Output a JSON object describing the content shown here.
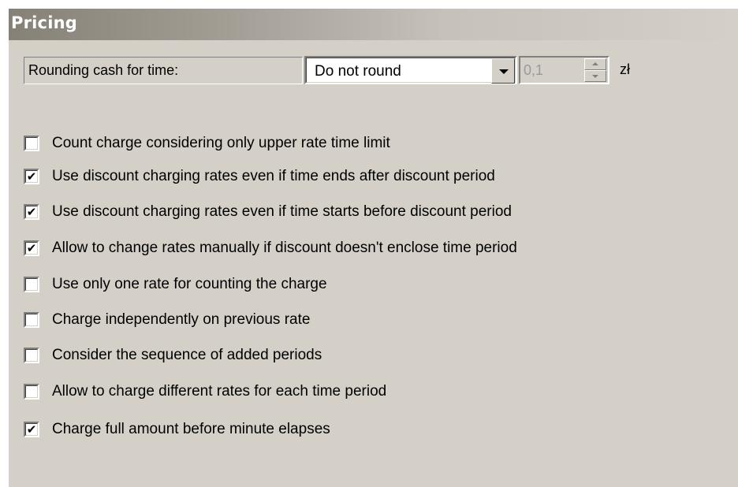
{
  "header": {
    "title": "Pricing"
  },
  "rounding": {
    "label": "Rounding cash for time:",
    "selected": "Do not round",
    "amount": "0,1",
    "currency": "zł"
  },
  "options": [
    {
      "label": "Count charge considering only upper rate time limit",
      "checked": false
    },
    {
      "label": "Use discount charging rates even if time ends after discount period",
      "checked": true
    },
    {
      "label": "Use discount charging rates even if time starts before discount period",
      "checked": true
    },
    {
      "label": "Allow to change rates manually if discount doesn't enclose time period",
      "checked": true
    },
    {
      "label": "Use only one rate for counting the charge",
      "checked": false
    },
    {
      "label": "Charge independently on previous rate",
      "checked": false
    },
    {
      "label": "Consider the sequence of added periods",
      "checked": false
    },
    {
      "label": "Allow to charge different rates for each time period",
      "checked": false
    },
    {
      "label": "Charge full amount before minute elapses",
      "checked": true
    }
  ]
}
